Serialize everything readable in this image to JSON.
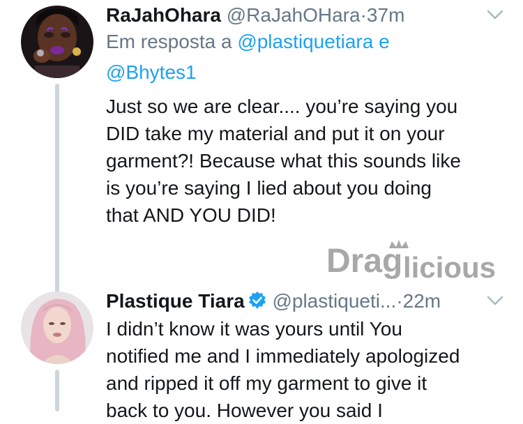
{
  "tweet1": {
    "display_name": "RaJahOhara",
    "handle": "@RaJahOHara",
    "separator": "·",
    "time": "37m",
    "reply_prefix": "Em resposta a",
    "reply_user1": "@plastiquetiara",
    "reply_conj": "e",
    "reply_user2": "@Bhytes1",
    "lines": [
      "Just so we are clear.... you’re saying you",
      "DID take my material and put it on your",
      "garment?!  Because what this sounds like",
      "is you’re saying I lied about you doing",
      "that AND YOU DID!"
    ]
  },
  "watermark": {
    "part1": "Drag",
    "part2": "licious"
  },
  "tweet2": {
    "display_name": "Plastique Tiara",
    "handle": "@plastiqueti...",
    "separator": "·",
    "time": "22m",
    "lines": [
      "I didn’t know it was yours until You",
      "notified me and I immediately apologized",
      "and ripped it off my garment to give it",
      "back to you. However you said I"
    ]
  },
  "colors": {
    "link": "#1da1f2",
    "muted": "#657786",
    "thread_line": "#ccd6dd",
    "verified": "#1da1f2"
  },
  "icons": [
    "chevron-down-icon",
    "verified-badge-icon"
  ]
}
